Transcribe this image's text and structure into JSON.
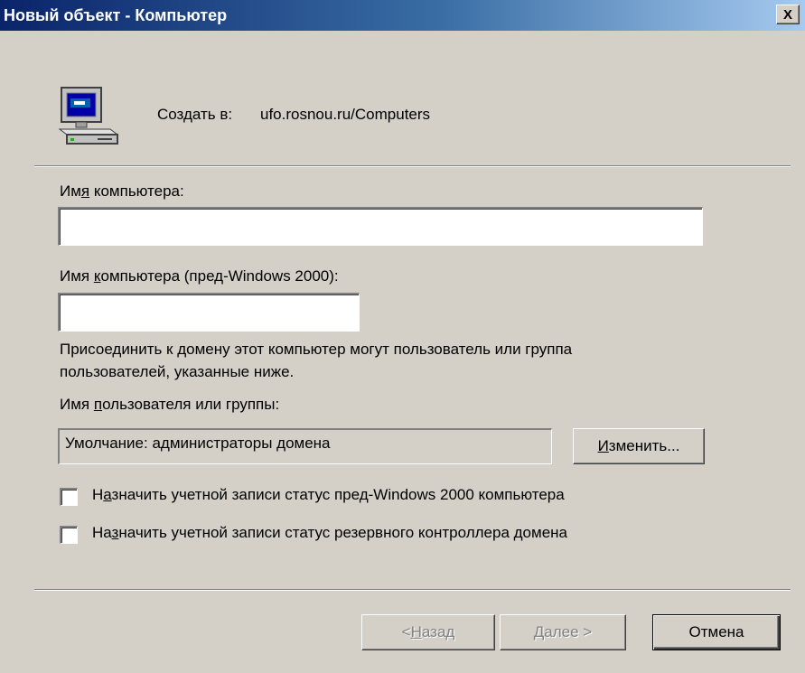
{
  "window": {
    "title": "Новый объект - Компьютер",
    "close_label": "X"
  },
  "header": {
    "icon": "computer-icon",
    "create_label": "Создать в:",
    "create_path": "ufo.rosnou.ru/Computers"
  },
  "form": {
    "computer_name": {
      "label_pre": "Им",
      "label_ul": "я",
      "label_post": " компьютера:",
      "value": ""
    },
    "pre2000_name": {
      "label_pre": "Имя ",
      "label_ul": "к",
      "label_post": "омпьютера (пред-Windows 2000):",
      "value": ""
    },
    "join_note_line1": "Присоединить к домену этот компьютер могут пользователь или группа",
    "join_note_line2": "пользователей, указанные ниже.",
    "user_group": {
      "label_pre": "Имя ",
      "label_ul": "п",
      "label_post": "ользователя или группы:",
      "value": "Умолчание: администраторы домена"
    },
    "change_button": {
      "label_ul": "И",
      "label_post": "зменить..."
    },
    "checkbox1": {
      "label_pre": "Н",
      "label_ul": "а",
      "label_post": "значить учетной записи статус пред-Windows 2000 компьютера",
      "checked": false
    },
    "checkbox2": {
      "label_pre": "На",
      "label_ul": "з",
      "label_post": "начить учетной записи статус резервного контроллера домена",
      "checked": false
    }
  },
  "footer": {
    "back_button": {
      "label_pre": "< ",
      "label_ul": "Н",
      "label_post": "азад"
    },
    "next_button": {
      "label_ul": "Д",
      "label_post": "алее >"
    },
    "cancel_button": {
      "label": "Отмена"
    }
  },
  "colors": {
    "dialog_bg": "#d4d0c8",
    "title_gradient_start": "#0a246a",
    "title_gradient_end": "#a6caf0"
  }
}
